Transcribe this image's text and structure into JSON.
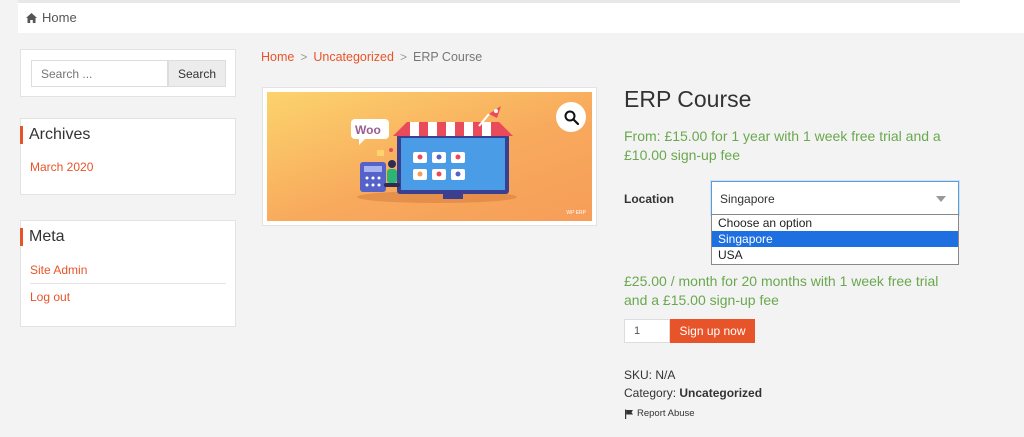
{
  "nav": {
    "home": "Home"
  },
  "sidebar": {
    "search": {
      "placeholder": "Search ...",
      "button": "Search"
    },
    "archives": {
      "title": "Archives",
      "items": [
        "March 2020"
      ]
    },
    "meta": {
      "title": "Meta",
      "items": [
        "Site Admin",
        "Log out"
      ]
    }
  },
  "breadcrumb": {
    "home": "Home",
    "category": "Uncategorized",
    "current": "ERP Course",
    "separator": ">"
  },
  "product": {
    "image_badge": "Woo",
    "image_watermark": "WP ERP",
    "title": "ERP Course",
    "price_from": "From: £15.00 for 1 year with 1 week free trial and a £10.00 sign-up fee",
    "location_label": "Location",
    "location_selected": "Singapore",
    "location_options": [
      "Choose an option",
      "Singapore",
      "USA"
    ],
    "price_variant": "£25.00 / month for 20 months with 1 week free trial and a £15.00 sign-up fee",
    "quantity": "1",
    "signup_button": "Sign up now",
    "sku_label": "SKU:",
    "sku_value": "N/A",
    "category_label": "Category:",
    "category_value": "Uncategorized",
    "report": "Report Abuse"
  },
  "colors": {
    "accent": "#e8542a",
    "price": "#6aa84f",
    "selected_option": "#1e6fe0"
  }
}
